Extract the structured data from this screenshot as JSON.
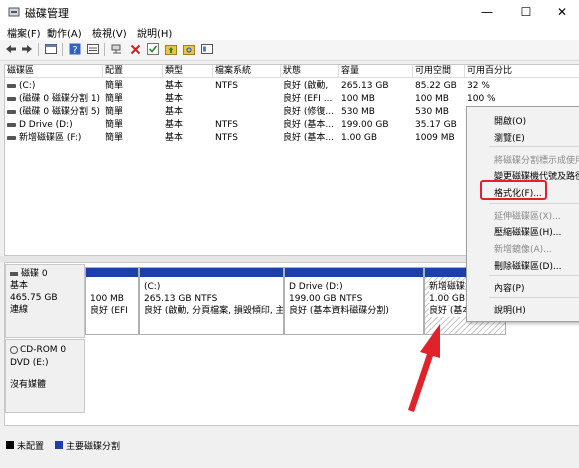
{
  "window": {
    "title": "磁碟管理",
    "minimize_glyph": "—",
    "maximize_glyph": "☐",
    "close_glyph": "✕"
  },
  "menu": [
    "檔案(F)",
    "動作(A)",
    "檢視(V)",
    "說明(H)"
  ],
  "toolbar_icons": [
    "back-arrow-icon",
    "forward-arrow-icon",
    "console-icon",
    "help-icon",
    "properties-icon",
    "connect-icon",
    "delete-icon",
    "check-icon",
    "folder-up-icon",
    "folder-search-icon",
    "view-icon"
  ],
  "volume_list": {
    "columns": [
      "磁碟區",
      "配置",
      "類型",
      "檔案系統",
      "狀態",
      "容量",
      "可用空間",
      "可用百分比"
    ],
    "rows": [
      [
        "(C:)",
        "簡單",
        "基本",
        "NTFS",
        "良好 (啟動,",
        "265.13 GB",
        "85.22 GB",
        "32 %"
      ],
      [
        "(磁碟 0 磁碟分割 1)",
        "簡單",
        "基本",
        "",
        "良好 (EFI ...",
        "100 MB",
        "100 MB",
        "100 %"
      ],
      [
        "(磁碟 0 磁碟分割 5)",
        "簡單",
        "基本",
        "",
        "良好 (修復...",
        "530 MB",
        "530 MB",
        ""
      ],
      [
        "D Drive (D:)",
        "簡單",
        "基本",
        "NTFS",
        "良好 (基本...",
        "199.00 GB",
        "35.17 GB",
        ""
      ],
      [
        "新增磁碟區 (F:)",
        "簡單",
        "基本",
        "NTFS",
        "良好 (基本...",
        "1.00 GB",
        "1009 MB",
        ""
      ]
    ]
  },
  "disk0": {
    "name": "磁碟 0",
    "type": "基本",
    "size": "465.75 GB",
    "status": "連線",
    "partitions": [
      {
        "line1": "",
        "line2": "100 MB",
        "line3": "良好 (EFI"
      },
      {
        "line1": "(C:)",
        "line2": "265.13 GB NTFS",
        "line3": "良好 (啟動, 分頁檔案, 損毀傾印, 主"
      },
      {
        "line1": "D Drive (D:)",
        "line2": "199.00 GB NTFS",
        "line3": "良好 (基本資料磁碟分割)"
      },
      {
        "line1": "新增磁碟",
        "line2": "1.00 GB N",
        "line3": "良好 (基本"
      }
    ]
  },
  "cdrom": {
    "name": "CD-ROM 0",
    "drive": "DVD (E:)",
    "media": "沒有媒體"
  },
  "legend": [
    {
      "label": "未配置",
      "color": "#000000"
    },
    {
      "label": "主要磁碟分割",
      "color": "#1f3fa8"
    }
  ],
  "context_menu": [
    {
      "label": "開啟(O)",
      "enabled": true
    },
    {
      "label": "瀏覽(E)",
      "enabled": true
    },
    {
      "label": "將磁碟分割標示成使用中",
      "enabled": false
    },
    {
      "label": "變更磁碟機代號及路徑",
      "enabled": true
    },
    {
      "label": "格式化(F)...",
      "enabled": true
    },
    {
      "label": "延伸磁碟區(X)...",
      "enabled": false
    },
    {
      "label": "壓縮磁碟區(H)...",
      "enabled": true
    },
    {
      "label": "新增鏡像(A)...",
      "enabled": false
    },
    {
      "label": "刪除磁碟區(D)...",
      "enabled": true
    },
    {
      "label": "內容(P)",
      "enabled": true
    },
    {
      "label": "說明(H)",
      "enabled": true
    }
  ],
  "colors": {
    "primary_partition": "#1f3fa8",
    "highlight": "#e0222b"
  }
}
